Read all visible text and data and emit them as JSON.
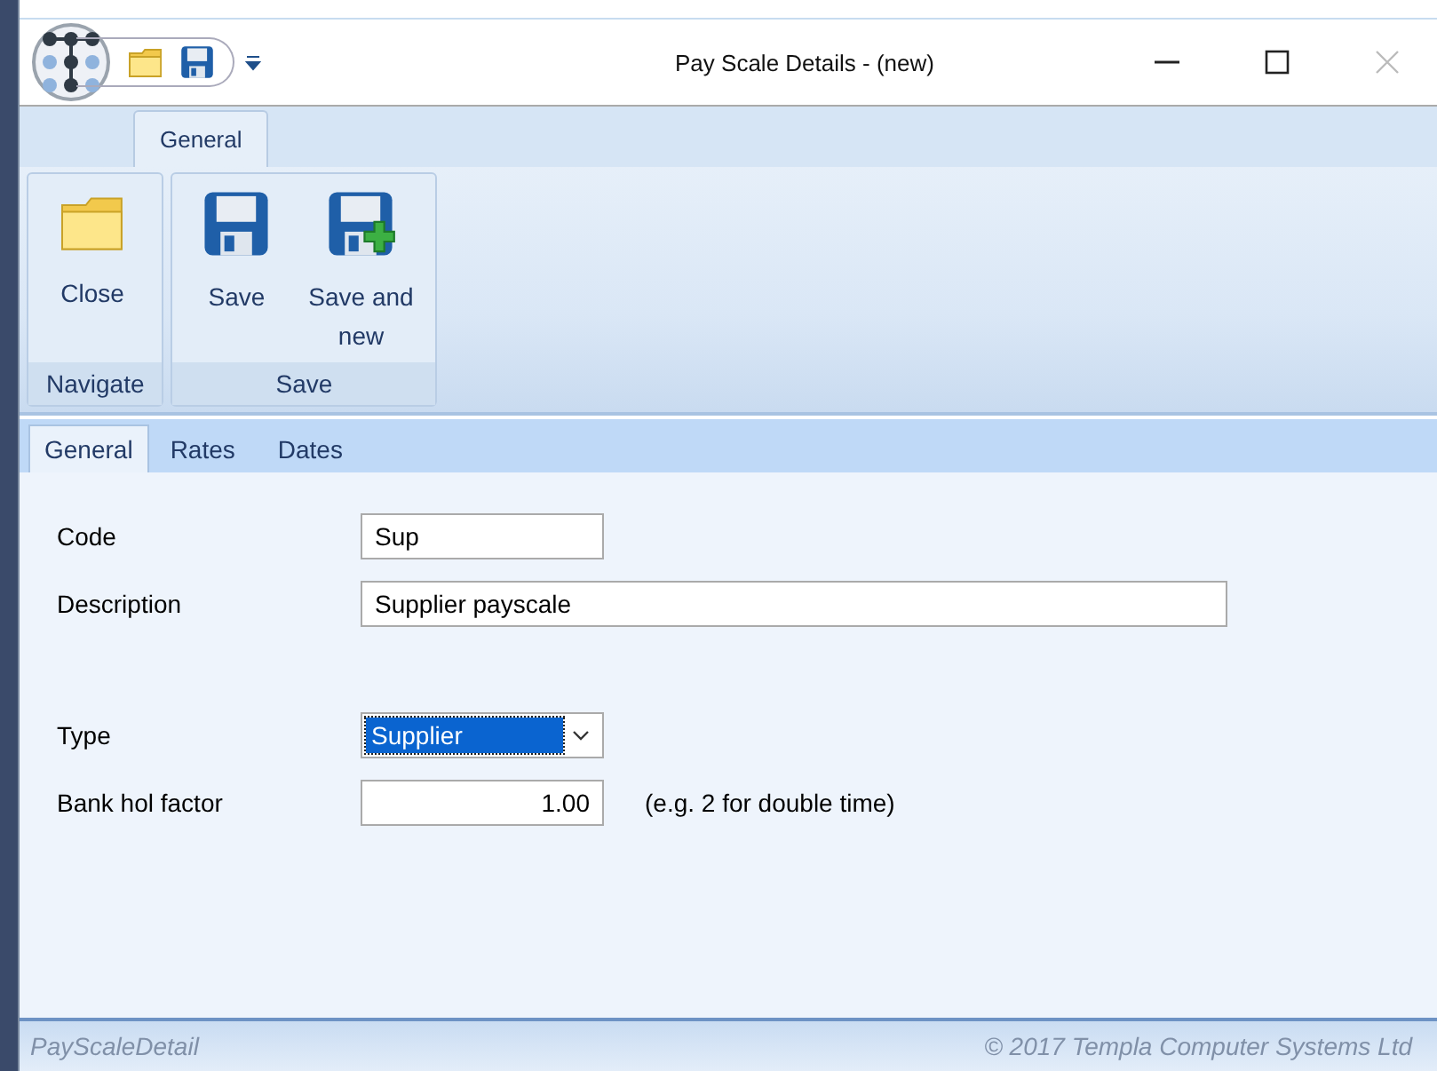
{
  "window": {
    "title": "Pay Scale Details - (new)"
  },
  "ribbon_tabs": [
    {
      "label": "General",
      "selected": true
    }
  ],
  "ribbon_groups": [
    {
      "label": "Navigate",
      "buttons": [
        {
          "label": "Close",
          "kind": "folder"
        }
      ]
    },
    {
      "label": "Save",
      "buttons": [
        {
          "label": "Save",
          "kind": "save"
        },
        {
          "label": "Save and new",
          "kind": "save-new"
        }
      ]
    }
  ],
  "tabs": [
    {
      "label": "General",
      "selected": true
    },
    {
      "label": "Rates",
      "selected": false
    },
    {
      "label": "Dates",
      "selected": false
    }
  ],
  "fields": [
    {
      "kind": "text",
      "label": "Code",
      "value": "Sup"
    },
    {
      "kind": "wide-text",
      "label": "Description",
      "value": "Supplier payscale"
    },
    {
      "kind": "gap"
    },
    {
      "kind": "dropdown",
      "label": "Type",
      "value": "Supplier",
      "focused": true
    },
    {
      "kind": "number",
      "label": "Bank hol factor",
      "value": "1.00",
      "hint": "(e.g. 2 for double time)"
    }
  ],
  "status_bar": {
    "left": "PayScaleDetail",
    "right": "© 2017 Templa Computer Systems Ltd"
  }
}
